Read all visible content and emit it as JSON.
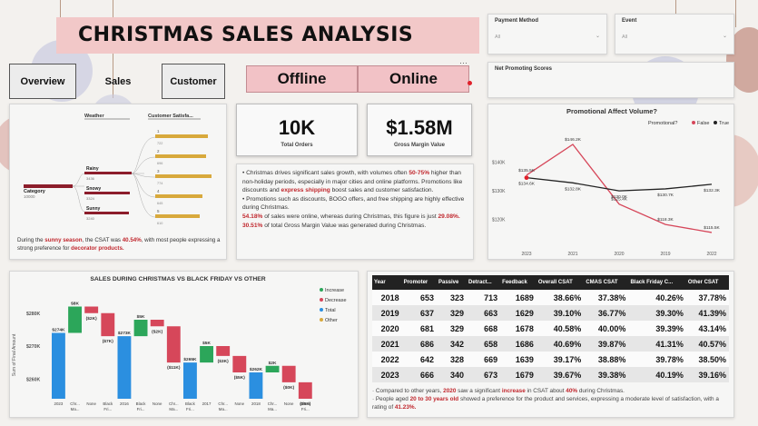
{
  "header": {
    "title": "CHRISTMAS SALES ANALYSIS"
  },
  "nav": {
    "overview": "Overview",
    "sales": "Sales",
    "customer": "Customer"
  },
  "channel_toggle": {
    "offline": "Offline",
    "online": "Online"
  },
  "slicers": {
    "payment_method": {
      "label": "Payment Method",
      "value": "All"
    },
    "event": {
      "label": "Event",
      "value": "All"
    },
    "nps": {
      "label": "Net Promoting Scores"
    }
  },
  "kpis": {
    "total_orders": {
      "value": "10K",
      "label": "Total Orders"
    },
    "gross_margin": {
      "value": "$1.58M",
      "label": "Gross Margin Value"
    }
  },
  "decomp_tree": {
    "headers": {
      "weather": "Weather",
      "customer_satisfaction": "Customer Satisfa..."
    },
    "root": {
      "label": "Category",
      "value": "10000"
    },
    "weather": [
      {
        "label": "Rainy",
        "value": "3436"
      },
      {
        "label": "Snowy",
        "value": "3324"
      },
      {
        "label": "Sunny",
        "value": "3240"
      }
    ],
    "csat": [
      "1",
      "2",
      "3",
      "4",
      "5"
    ],
    "csat_values": [
      "722",
      "696",
      "774",
      "645",
      "610"
    ],
    "caption_pre": "During the",
    "caption_b1": "sunny season",
    "caption_mid": ", the CSAT was",
    "caption_b2": "40.54%",
    "caption_mid2": ", with most people expressing a strong preference for",
    "caption_b3": "decorator products."
  },
  "insights": {
    "p1_pre": "Christmas drives significant sales growth, with volumes often ",
    "p1_b1": "50-75%",
    "p1_mid": " higher than non-holiday periods, especially in major cities and online platforms. Promotions like discounts and ",
    "p1_b2": "express shipping",
    "p1_post": " boost sales and customer satisfaction.",
    "p2": "Promotions such as discounts, BOGO offers, and free shipping are highly effective during Christmas.",
    "p3_b1": "54.18%",
    "p3_mid": " of sales were online, whereas during Christmas, this figure is just ",
    "p3_b2": "29.08%.",
    "p4_b1": "30.51%",
    "p4_post": " of total Gross Margin Value was generated during Christmas."
  },
  "line_chart": {
    "title": "Promotional Affect Volume?",
    "legend_title": "Promotional?",
    "legend": [
      "False",
      "True"
    ],
    "colors": {
      "false": "#d6475a",
      "true": "#222222"
    }
  },
  "waterfall": {
    "title": "SALES DURING CHRISTMAS VS BLACK FRIDAY VS OTHER",
    "ylabel": "Sum of Final Amount",
    "legend": [
      "Increase",
      "Decrease",
      "Total",
      "Other"
    ],
    "colors": {
      "increase": "#2ca65a",
      "decrease": "#d6475a",
      "total": "#2b8fe0",
      "other": "#d8a93c"
    }
  },
  "csat_table": {
    "columns": [
      "Year",
      "Promoter",
      "Passive",
      "Detract...",
      "Feedback",
      "Overall CSAT",
      "CMAS CSAT",
      "Black Friday C...",
      "Other CSAT"
    ],
    "rows": [
      [
        "2018",
        "653",
        "323",
        "713",
        "1689",
        "38.66%",
        "37.38%",
        "40.26%",
        "37.78%"
      ],
      [
        "2019",
        "637",
        "329",
        "663",
        "1629",
        "39.10%",
        "36.77%",
        "39.30%",
        "41.39%"
      ],
      [
        "2020",
        "681",
        "329",
        "668",
        "1678",
        "40.58%",
        "40.00%",
        "39.39%",
        "43.14%"
      ],
      [
        "2021",
        "686",
        "342",
        "658",
        "1686",
        "40.69%",
        "39.87%",
        "41.31%",
        "40.57%"
      ],
      [
        "2022",
        "642",
        "328",
        "669",
        "1639",
        "39.17%",
        "38.88%",
        "39.78%",
        "38.50%"
      ],
      [
        "2023",
        "666",
        "340",
        "673",
        "1679",
        "39.67%",
        "39.38%",
        "40.19%",
        "39.16%"
      ]
    ],
    "note1_pre": "Compared to other years, ",
    "note1_b1": "2020",
    "note1_mid": " saw a significant ",
    "note1_b2": "increase",
    "note1_mid2": " in CSAT about ",
    "note1_b3": "40%",
    "note1_post": " during Christmas.",
    "note2_pre": "People aged ",
    "note2_b1": "20 to 30 years old",
    "note2_mid": " showed a preference for the product and services, expressing a moderate level of satisfaction, with a rating of ",
    "note2_b2": "41.23%."
  },
  "chart_data": [
    {
      "type": "line",
      "title": "Promotional Affect Volume?",
      "x": [
        "2023",
        "2021",
        "2020",
        "2019",
        "2022"
      ],
      "series": [
        {
          "name": "False",
          "values": [
            135.5,
            146.2,
            125.4,
            118.3,
            115.5
          ],
          "labels": [
            "$135.5K",
            "$146.2K",
            "$125.4K",
            "$118.3K",
            "$115.5K"
          ]
        },
        {
          "name": "True",
          "values": [
            134.6,
            132.8,
            130.0,
            130.7,
            132.3
          ],
          "labels": [
            "$134.6K",
            "$132.8K",
            "$130.0K",
            "$130.7K",
            "$132.3K"
          ]
        }
      ],
      "extra_labels": [
        "$138.8K",
        "$131.5K",
        "$132.1K",
        "$126.5K"
      ],
      "yticks": [
        "$140K",
        "$130K",
        "$120K"
      ],
      "ylim": [
        112,
        150
      ]
    },
    {
      "type": "bar",
      "title": "SALES DURING CHRISTMAS VS BLACK FRIDAY VS OTHER",
      "categories": [
        "2023",
        "Chr... Ma...",
        "None",
        "Black Fri...",
        "2016",
        "Black Fri...",
        "None",
        "Chr... Ma...",
        "Black Fri...",
        "2017",
        "Chr... Ma...",
        "None",
        "2018",
        "Chr... Ma...",
        "None",
        "Black Fri..."
      ],
      "bars": [
        {
          "kind": "total",
          "start": 0,
          "end": 274,
          "label": "$274K"
        },
        {
          "kind": "increase",
          "start": 274,
          "end": 282,
          "label": "$8K"
        },
        {
          "kind": "decrease",
          "start": 282,
          "end": 280,
          "label": "($2K)"
        },
        {
          "kind": "decrease",
          "start": 280,
          "end": 273,
          "label": "($7K)"
        },
        {
          "kind": "total",
          "start": 0,
          "end": 273,
          "label": "$273K"
        },
        {
          "kind": "increase",
          "start": 273,
          "end": 278,
          "label": "$5K"
        },
        {
          "kind": "decrease",
          "start": 278,
          "end": 276,
          "label": "($2K)"
        },
        {
          "kind": "decrease",
          "start": 276,
          "end": 265,
          "label": "($11K)"
        },
        {
          "kind": "total",
          "start": 0,
          "end": 265,
          "label": "$265K"
        },
        {
          "kind": "increase",
          "start": 265,
          "end": 270,
          "label": "$5K"
        },
        {
          "kind": "decrease",
          "start": 270,
          "end": 267,
          "label": "($3K)"
        },
        {
          "kind": "decrease",
          "start": 267,
          "end": 262,
          "label": "($5K)"
        },
        {
          "kind": "total",
          "start": 0,
          "end": 262,
          "label": "$262K"
        },
        {
          "kind": "increase",
          "start": 262,
          "end": 264,
          "label": "$2K"
        },
        {
          "kind": "decrease",
          "start": 264,
          "end": 259,
          "label": "($0K)"
        },
        {
          "kind": "decrease",
          "start": 259,
          "end": 254,
          "label": "($9K)"
        }
      ],
      "yticks": [
        "$280K",
        "$270K",
        "$260K"
      ],
      "ylim": [
        254,
        286
      ]
    }
  ]
}
